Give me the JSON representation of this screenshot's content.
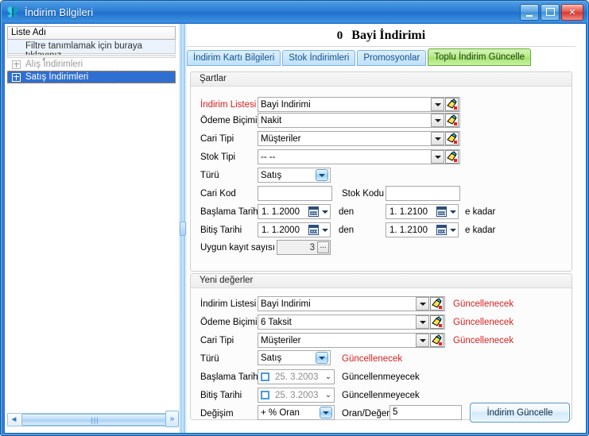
{
  "window": {
    "title": "İndirim Bilgileri",
    "icon": "butterfly-icon",
    "minimize": "_",
    "maximize": "□",
    "close": "✕"
  },
  "left_panel": {
    "header": "Liste Adı",
    "filter_hint": "Filtre tanımlamak için buraya tıklayınız",
    "tree": [
      {
        "label": "Alış İndirimleri",
        "selected": false
      },
      {
        "label": "Satış İndirimleri",
        "selected": true
      }
    ],
    "scrollbar": {
      "left_arrow": "◄",
      "right_arrow": "►",
      "grip": "|||"
    },
    "splitter_expand": "»"
  },
  "header": {
    "record_no": "0",
    "record_title": "Bayi İndirimi"
  },
  "tabs": [
    {
      "label": "İndirim Kartı Bilgileri",
      "active": false
    },
    {
      "label": "Stok İndirimleri",
      "active": false
    },
    {
      "label": "Promosyonlar",
      "active": false
    },
    {
      "label": "Toplu İndirim Güncelle",
      "active": true
    }
  ],
  "conditions": {
    "title": "Şartlar",
    "discount_list": {
      "label": "İndirim Listesi",
      "value": "Bayi İndirimi"
    },
    "payment_type": {
      "label": "Ödeme Biçimi",
      "value": "Nakit"
    },
    "account_type": {
      "label": "Cari Tipi",
      "value": "Müşteriler"
    },
    "stock_type": {
      "label": "Stok Tipi",
      "value": "-- --"
    },
    "kind": {
      "label": "Türü",
      "value": "Satış"
    },
    "account_code": {
      "label": "Cari Kod",
      "value": ""
    },
    "stock_code": {
      "label": "Stok Kodu",
      "value": ""
    },
    "start_date": {
      "label": "Başlama Tarihi",
      "from": "1. 1.2000",
      "to": "1. 1.2100"
    },
    "end_date": {
      "label": "Bitiş Tarihi",
      "from": "1. 1.2000",
      "to": "1. 1.2100"
    },
    "from_word": "den",
    "to_word": "e kadar",
    "match_count": {
      "label": "Uygun kayıt sayısı",
      "value": "3",
      "ellipsis": "..."
    }
  },
  "new_values": {
    "title": "Yeni değerler",
    "discount_list": {
      "label": "İndirim Listesi",
      "value": "Bayi İndirimi",
      "status": "Güncellenecek"
    },
    "payment_type": {
      "label": "Ödeme Biçimi",
      "value": "6 Taksit",
      "status": "Güncellenecek"
    },
    "account_type": {
      "label": "Cari Tipi",
      "value": "Müşteriler",
      "status": "Güncellenecek"
    },
    "kind": {
      "label": "Türü",
      "value": "Satış",
      "status": "Güncellenecek"
    },
    "start_date": {
      "label": "Başlama Tarihi",
      "value": "25.  3.2003",
      "status": "Güncellenmeyecek"
    },
    "end_date": {
      "label": "Bitiş Tarihi",
      "value": "25.  3.2003",
      "status": "Güncellenmeyecek"
    },
    "change": {
      "label": "Değişim",
      "value": "+ % Oran"
    },
    "rate_value": {
      "label": "Oran/Değer",
      "value": "5"
    },
    "update_button": "İndirim Güncelle"
  },
  "colors": {
    "accent": "#2f7fd8",
    "required_label": "#d91e1e",
    "status_text": "#d91e1e",
    "active_tab": "#a4e36c",
    "selection": "#2f6fd0"
  }
}
